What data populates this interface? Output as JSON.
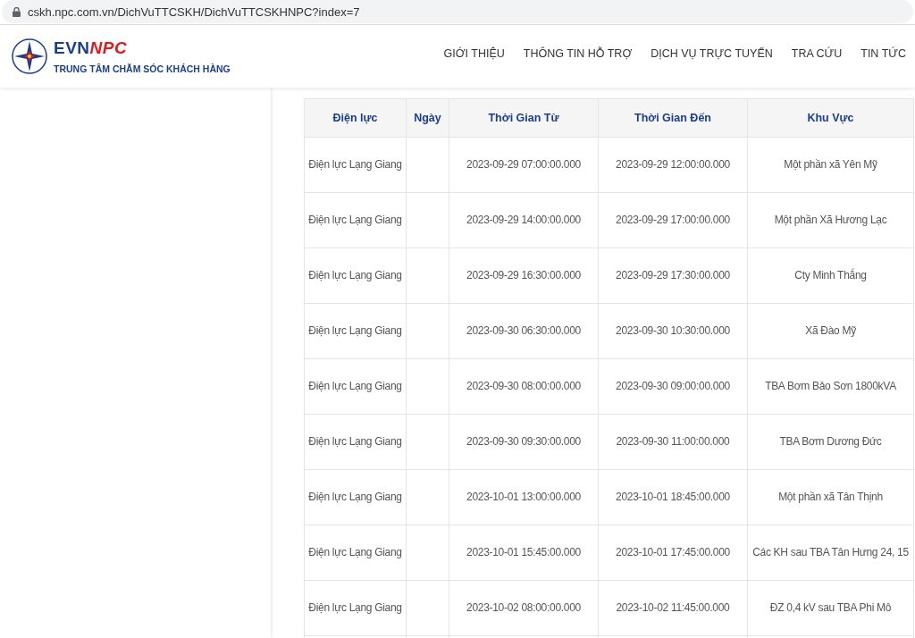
{
  "address_bar": {
    "url": "cskh.npc.com.vn/DichVuTTCSKH/DichVuTTCSKHNPC?index=7"
  },
  "header": {
    "logo": {
      "brand_part_1": "EVN",
      "brand_part_2": "NPC",
      "subtitle": "TRUNG TÂM CHĂM SÓC KHÁCH HÀNG"
    },
    "nav": [
      "GIỚI THIỆU",
      "THÔNG TIN HỖ TRỢ",
      "DỊCH VỤ TRỰC TUYẾN",
      "TRA CỨU",
      "TIN TỨC"
    ]
  },
  "table": {
    "columns": [
      "Điện lực",
      "Ngày",
      "Thời Gian Từ",
      "Thời Gian Đến",
      "Khu Vực"
    ],
    "rows": [
      [
        "Điện lực Lạng Giang",
        "",
        "2023-09-29 07:00:00.000",
        "2023-09-29 12:00:00.000",
        "Một phần xã Yên Mỹ"
      ],
      [
        "Điện lực Lạng Giang",
        "",
        "2023-09-29 14:00:00.000",
        "2023-09-29 17:00:00.000",
        "Một phần Xã Hương Lạc"
      ],
      [
        "Điện lực Lạng Giang",
        "",
        "2023-09-29 16:30:00.000",
        "2023-09-29 17:30:00.000",
        "Cty Minh Thắng"
      ],
      [
        "Điện lực Lạng Giang",
        "",
        "2023-09-30 06:30:00.000",
        "2023-09-30 10:30:00.000",
        "Xã Đào Mỹ"
      ],
      [
        "Điện lực Lạng Giang",
        "",
        "2023-09-30 08:00:00.000",
        "2023-09-30 09:00:00.000",
        "TBA Bơm Bảo Sơn 1800kVA"
      ],
      [
        "Điện lực Lạng Giang",
        "",
        "2023-09-30 09:30:00.000",
        "2023-09-30 11:00:00.000",
        "TBA Bơm Dương Đức"
      ],
      [
        "Điện lực Lạng Giang",
        "",
        "2023-10-01 13:00:00.000",
        "2023-10-01 18:45:00.000",
        "Một phần xã Tân Thịnh"
      ],
      [
        "Điện lực Lạng Giang",
        "",
        "2023-10-01 15:45:00.000",
        "2023-10-01 17:45:00.000",
        "Các KH sau TBA Tân Hưng 24, 15"
      ],
      [
        "Điện lực Lạng Giang",
        "",
        "2023-10-02 08:00:00.000",
        "2023-10-02 11:45:00.000",
        "ĐZ 0,4 kV sau TBA Phi Mô"
      ]
    ]
  }
}
